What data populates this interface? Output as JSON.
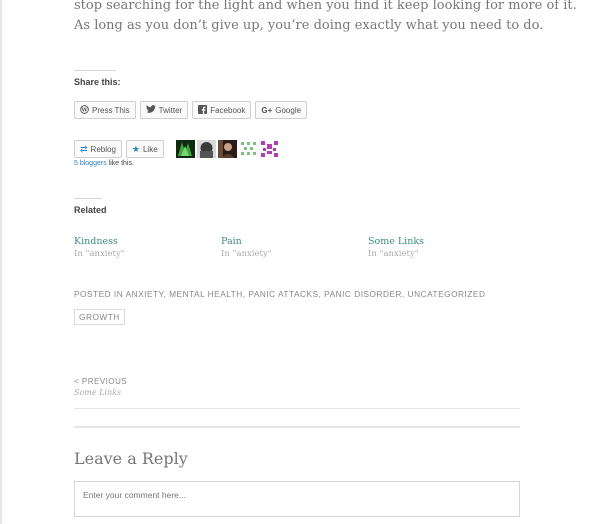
{
  "post": {
    "paragraph_lines": [
      "stop searching for the light and when you find it keep looking for more of it.",
      "As long as you don’t give up, you’re doing exactly what you need to do."
    ]
  },
  "share": {
    "heading": "Share this:",
    "buttons": [
      {
        "label": "Press This",
        "icon": "wordpress-icon"
      },
      {
        "label": "Twitter",
        "icon": "twitter-icon"
      },
      {
        "label": "Facebook",
        "icon": "facebook-icon"
      },
      {
        "label": "Google",
        "icon": "google-plus-icon"
      }
    ]
  },
  "likes": {
    "reblog_label": "Reblog",
    "like_label": "Like",
    "count_link": "5 bloggers",
    "count_suffix": " like this.",
    "avatar_colors": [
      "#2e6b2a",
      "#3a3a3a",
      "#5a3d2e",
      "#7fbf7f",
      "#b53ab5"
    ]
  },
  "related": {
    "heading": "Related",
    "items": [
      {
        "title": "Kindness",
        "sub": "In \"anxiety\""
      },
      {
        "title": "Pain",
        "sub": "In \"anxiety\""
      },
      {
        "title": "Some Links",
        "sub": "In \"anxiety\""
      }
    ]
  },
  "tags": {
    "prefix": "Posted in",
    "categories": [
      "anxiety",
      "mental health",
      "panic attacks",
      "panic disorder",
      "uncategorized"
    ],
    "tag": "growth"
  },
  "nav": {
    "previous_label": "< Previous",
    "previous_title": "Some Links"
  },
  "reply": {
    "title": "Leave a Reply",
    "placeholder": "Enter your comment here..."
  }
}
